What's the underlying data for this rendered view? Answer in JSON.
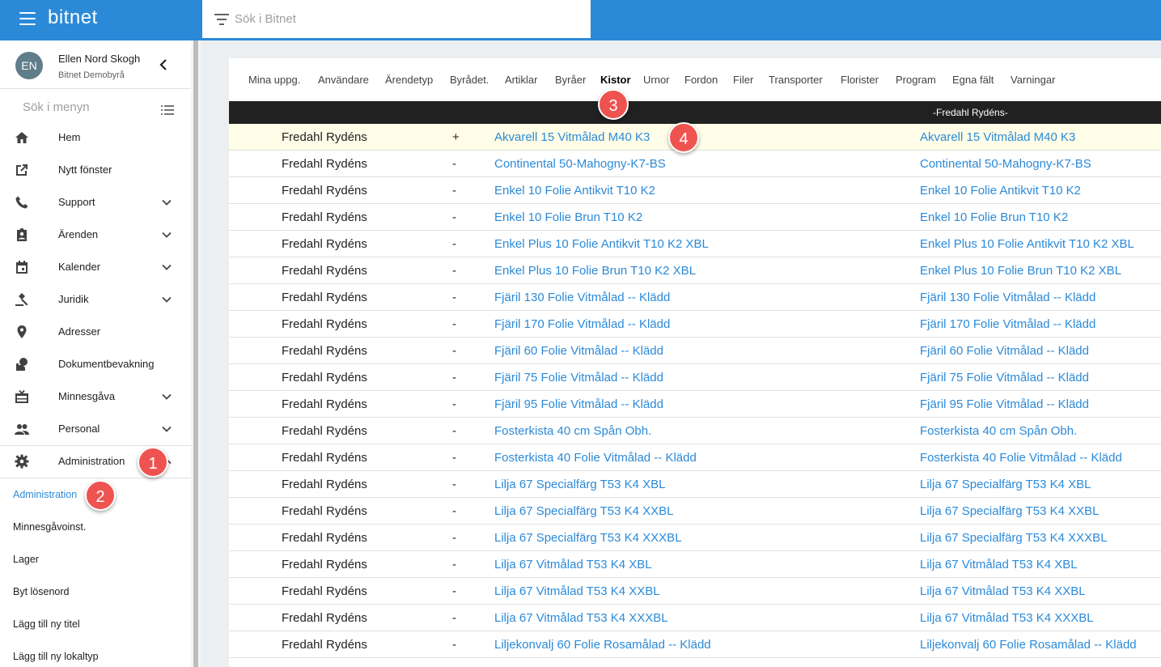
{
  "app": {
    "brand": "bitnet"
  },
  "search": {
    "placeholder": "Sök i Bitnet"
  },
  "user": {
    "initials": "EN",
    "name": "Ellen Nord Skogh",
    "org": "Bitnet Demobyrå"
  },
  "sidebar": {
    "search_label": "Sök i menyn",
    "items": [
      {
        "label": "Hem",
        "icon": "home-icon",
        "expandable": false
      },
      {
        "label": "Nytt fönster",
        "icon": "open-new-icon",
        "expandable": false
      },
      {
        "label": "Support",
        "icon": "phone-icon",
        "expandable": true
      },
      {
        "label": "Ärenden",
        "icon": "clipboard-icon",
        "expandable": true
      },
      {
        "label": "Kalender",
        "icon": "calendar-icon",
        "expandable": true
      },
      {
        "label": "Juridik",
        "icon": "gavel-icon",
        "expandable": true
      },
      {
        "label": "Adresser",
        "icon": "location-pin-icon",
        "expandable": false
      },
      {
        "label": "Dokumentbevakning",
        "icon": "document-watch-icon",
        "expandable": false
      },
      {
        "label": "Minnesgåva",
        "icon": "gift-icon",
        "expandable": true
      },
      {
        "label": "Personal",
        "icon": "people-icon",
        "expandable": true
      },
      {
        "label": "Administration",
        "icon": "gear-icon",
        "expandable": true
      }
    ],
    "sub_items": [
      {
        "label": "Administration",
        "active": true
      },
      {
        "label": "Minnesgåvoinst.",
        "active": false
      },
      {
        "label": "Lager",
        "active": false
      },
      {
        "label": "Byt lösenord",
        "active": false
      },
      {
        "label": "Lägg till ny titel",
        "active": false
      },
      {
        "label": "Lägg till ny lokaltyp",
        "active": false
      }
    ]
  },
  "tabs": [
    {
      "label": "Mina uppg.",
      "active": false
    },
    {
      "label": "Användare",
      "active": false
    },
    {
      "label": "Ärendetyp",
      "active": false
    },
    {
      "label": "Byrådet.",
      "active": false
    },
    {
      "label": "Artiklar",
      "active": false
    },
    {
      "label": "Byråer",
      "active": false
    },
    {
      "label": "Kistor",
      "active": true
    },
    {
      "label": "Urnor",
      "active": false
    },
    {
      "label": "Fordon",
      "active": false
    },
    {
      "label": "Filer",
      "active": false
    },
    {
      "label": "Transporter",
      "active": false
    },
    {
      "label": "Florister",
      "active": false
    },
    {
      "label": "Program",
      "active": false
    },
    {
      "label": "Egna fält",
      "active": false
    },
    {
      "label": "Varningar",
      "active": false
    }
  ],
  "table": {
    "header_right": "-Fredahl Rydéns-",
    "rows": [
      {
        "supplier": "Fredahl Rydéns",
        "flag": "+",
        "name": "Akvarell 15 Vitmålad M40 K3",
        "name2": "Akvarell 15 Vitmålad M40 K3",
        "highlight": true
      },
      {
        "supplier": "Fredahl Rydéns",
        "flag": "-",
        "name": "Continental 50-Mahogny-K7-BS",
        "name2": "Continental 50-Mahogny-K7-BS"
      },
      {
        "supplier": "Fredahl Rydéns",
        "flag": "-",
        "name": "Enkel 10 Folie Antikvit T10 K2",
        "name2": "Enkel 10 Folie Antikvit T10 K2"
      },
      {
        "supplier": "Fredahl Rydéns",
        "flag": "-",
        "name": "Enkel 10 Folie Brun T10 K2",
        "name2": "Enkel 10 Folie Brun T10 K2"
      },
      {
        "supplier": "Fredahl Rydéns",
        "flag": "-",
        "name": "Enkel Plus 10 Folie Antikvit T10 K2 XBL",
        "name2": "Enkel Plus 10 Folie Antikvit T10 K2 XBL"
      },
      {
        "supplier": "Fredahl Rydéns",
        "flag": "-",
        "name": "Enkel Plus 10 Folie Brun T10 K2 XBL",
        "name2": "Enkel Plus 10 Folie Brun T10 K2 XBL"
      },
      {
        "supplier": "Fredahl Rydéns",
        "flag": "-",
        "name": "Fjäril 130 Folie Vitmålad -- Klädd",
        "name2": "Fjäril 130 Folie Vitmålad -- Klädd"
      },
      {
        "supplier": "Fredahl Rydéns",
        "flag": "-",
        "name": "Fjäril 170 Folie Vitmålad -- Klädd",
        "name2": "Fjäril 170 Folie Vitmålad -- Klädd"
      },
      {
        "supplier": "Fredahl Rydéns",
        "flag": "-",
        "name": "Fjäril 60 Folie Vitmålad -- Klädd",
        "name2": "Fjäril 60 Folie Vitmålad -- Klädd"
      },
      {
        "supplier": "Fredahl Rydéns",
        "flag": "-",
        "name": "Fjäril 75 Folie Vitmålad -- Klädd",
        "name2": "Fjäril 75 Folie Vitmålad -- Klädd"
      },
      {
        "supplier": "Fredahl Rydéns",
        "flag": "-",
        "name": "Fjäril 95 Folie Vitmålad -- Klädd",
        "name2": "Fjäril 95 Folie Vitmålad -- Klädd"
      },
      {
        "supplier": "Fredahl Rydéns",
        "flag": "-",
        "name": "Fosterkista 40 cm Spån Obh.",
        "name2": "Fosterkista 40 cm Spån Obh."
      },
      {
        "supplier": "Fredahl Rydéns",
        "flag": "-",
        "name": "Fosterkista 40 Folie Vitmålad -- Klädd",
        "name2": "Fosterkista 40 Folie Vitmålad -- Klädd"
      },
      {
        "supplier": "Fredahl Rydéns",
        "flag": "-",
        "name": "Lilja 67 Specialfärg T53 K4 XBL",
        "name2": "Lilja 67 Specialfärg T53 K4 XBL"
      },
      {
        "supplier": "Fredahl Rydéns",
        "flag": "-",
        "name": "Lilja 67 Specialfärg T53 K4 XXBL",
        "name2": "Lilja 67 Specialfärg T53 K4 XXBL"
      },
      {
        "supplier": "Fredahl Rydéns",
        "flag": "-",
        "name": "Lilja 67 Specialfärg T53 K4 XXXBL",
        "name2": "Lilja 67 Specialfärg T53 K4 XXXBL"
      },
      {
        "supplier": "Fredahl Rydéns",
        "flag": "-",
        "name": "Lilja 67 Vitmålad T53 K4 XBL",
        "name2": "Lilja 67 Vitmålad T53 K4 XBL"
      },
      {
        "supplier": "Fredahl Rydéns",
        "flag": "-",
        "name": "Lilja 67 Vitmålad T53 K4 XXBL",
        "name2": "Lilja 67 Vitmålad T53 K4 XXBL"
      },
      {
        "supplier": "Fredahl Rydéns",
        "flag": "-",
        "name": "Lilja 67 Vitmålad T53 K4 XXXBL",
        "name2": "Lilja 67 Vitmålad T53 K4 XXXBL"
      },
      {
        "supplier": "Fredahl Rydéns",
        "flag": "-",
        "name": "Liljekonvalj 60 Folie Rosamålad -- Klädd",
        "name2": "Liljekonvalj 60 Folie Rosamålad -- Klädd"
      }
    ]
  },
  "badges": [
    "1",
    "2",
    "3",
    "4"
  ],
  "colors": {
    "primary": "#2b8ad8",
    "badge": "#ef5350",
    "highlight_row": "#fffde7",
    "table_header": "#212121"
  }
}
